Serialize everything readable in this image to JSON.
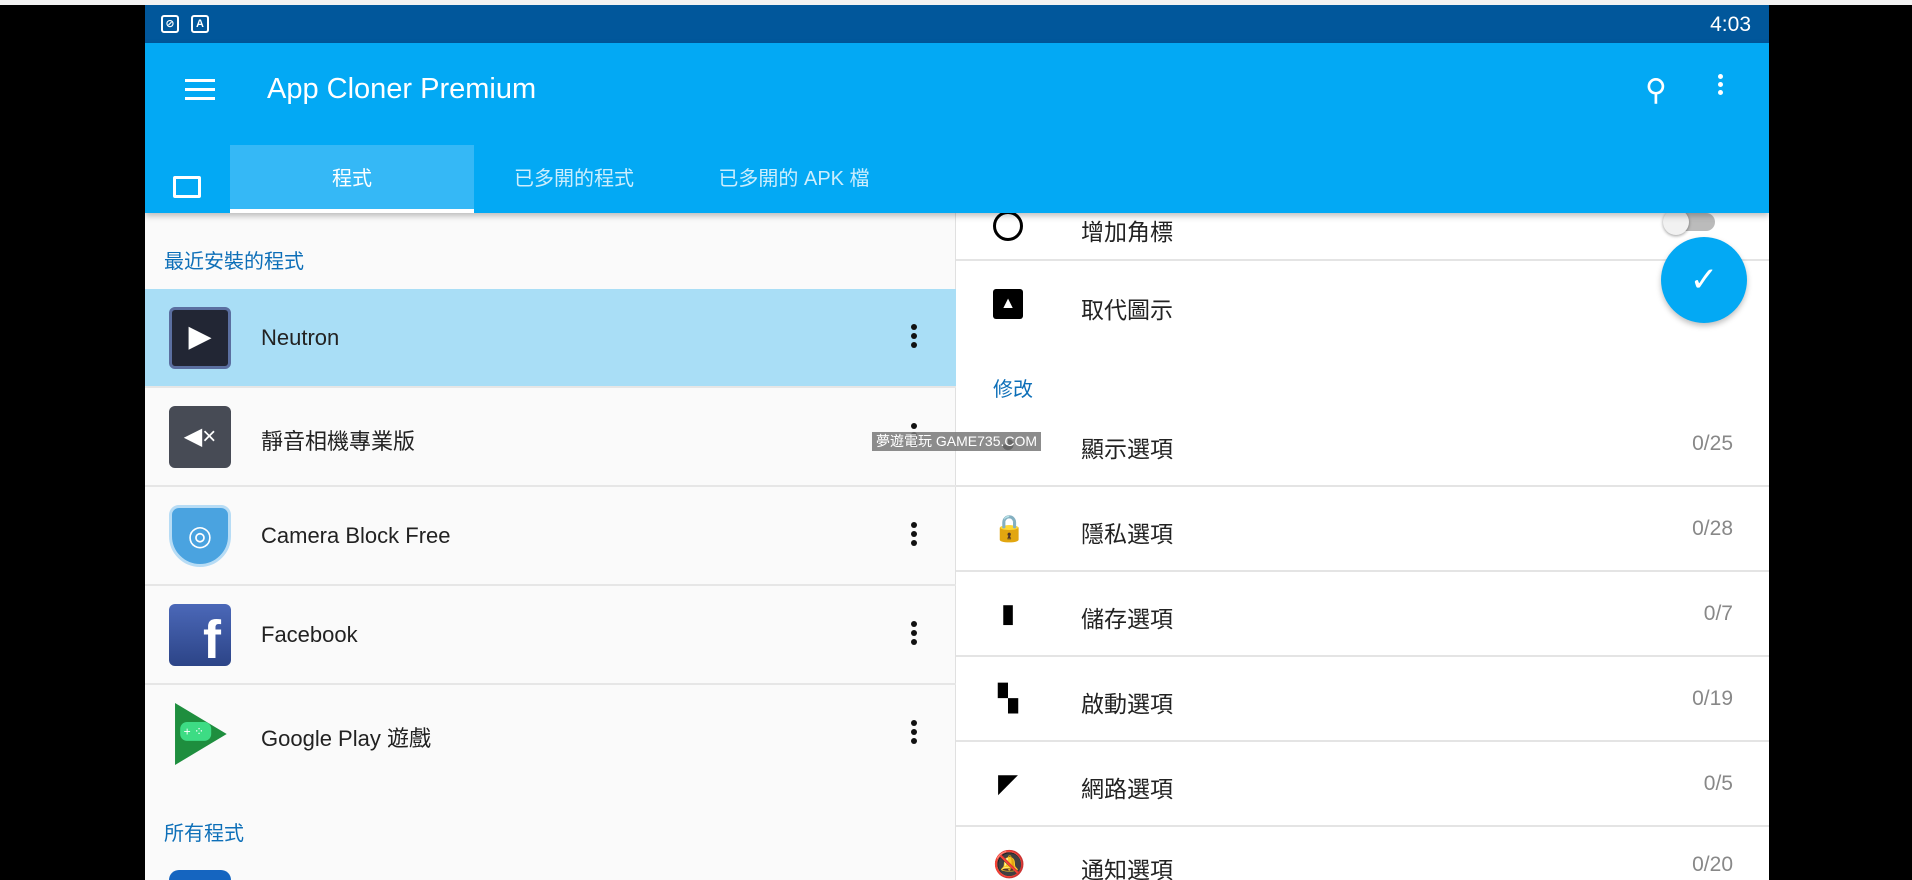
{
  "status_bar": {
    "time": "4:03",
    "icons": [
      "camera-off-icon",
      "a-icon"
    ]
  },
  "app_bar": {
    "title": "App Cloner Premium",
    "icons": [
      "menu-icon",
      "search-icon",
      "more-vert-icon"
    ]
  },
  "tabs": [
    {
      "label": "程式",
      "active": true
    },
    {
      "label": "已多開的程式"
    },
    {
      "label": "已多開的 APK 檔"
    }
  ],
  "left": {
    "recent_header": "最近安裝的程式",
    "apps": [
      {
        "name": "Neutron",
        "selected": true
      },
      {
        "name": "靜音相機專業版"
      },
      {
        "name": "Camera Block Free"
      },
      {
        "name": "Facebook"
      },
      {
        "name": "Google Play 遊戲"
      }
    ],
    "all_header": "所有程式"
  },
  "right": {
    "partial_item": "增加角標",
    "replace_icon": "取代圖示",
    "section": "修改",
    "options": [
      {
        "label": "顯示選項",
        "count": "0/25",
        "icon": "palette-icon"
      },
      {
        "label": "隱私選項",
        "count": "0/28",
        "icon": "lock-icon"
      },
      {
        "label": "儲存選項",
        "count": "0/7",
        "icon": "sd-card-icon"
      },
      {
        "label": "啟動選項",
        "count": "0/19",
        "icon": "widgets-icon"
      },
      {
        "label": "網路選項",
        "count": "0/5",
        "icon": "wifi-lock-icon"
      },
      {
        "label": "通知選項",
        "count": "0/20",
        "icon": "notifications-off-icon"
      }
    ]
  },
  "watermark": "夢遊電玩 GAME735.COM",
  "colors": {
    "primary": "#03a9f4",
    "status": "#01579b",
    "accent_text": "#0d6fb8",
    "selected": "#a9def6"
  }
}
